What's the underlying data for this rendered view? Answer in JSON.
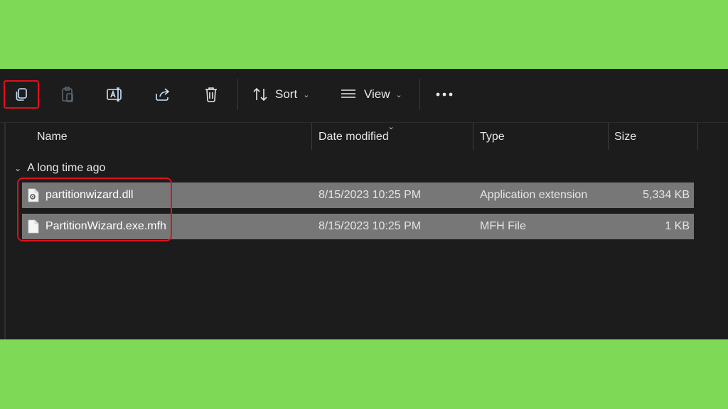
{
  "toolbar": {
    "sort_label": "Sort",
    "view_label": "View"
  },
  "columns": {
    "name": "Name",
    "date_modified": "Date modified",
    "type": "Type",
    "size": "Size"
  },
  "group": {
    "label": "A long time ago"
  },
  "files": [
    {
      "name": "partitionwizard.dll",
      "date_modified": "8/15/2023 10:25 PM",
      "type": "Application extension",
      "size": "5,334 KB",
      "icon": "dll-file-icon"
    },
    {
      "name": "PartitionWizard.exe.mfh",
      "date_modified": "8/15/2023 10:25 PM",
      "type": "MFH File",
      "size": "1 KB",
      "icon": "generic-file-icon"
    }
  ],
  "colors": {
    "background": "#7ed957",
    "window": "#1c1c1c",
    "selected_row": "#777777",
    "highlight": "#e0101b"
  }
}
